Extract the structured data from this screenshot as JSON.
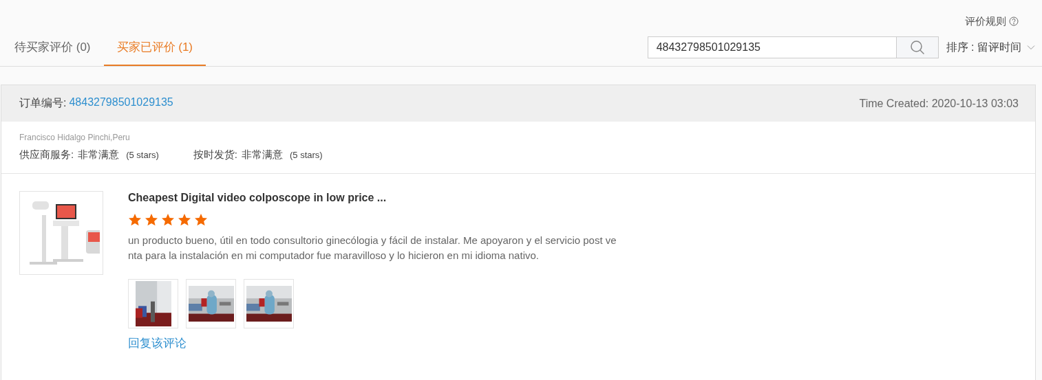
{
  "rules_link": "评价规则",
  "tabs": [
    {
      "label": "待买家评价 (0)",
      "selected": false
    },
    {
      "label": "买家已评价 (1)",
      "selected": true
    }
  ],
  "search": {
    "value": "48432798501029135"
  },
  "sort": {
    "label": "排序 : 留评时间"
  },
  "order": {
    "label": "订单编号:",
    "number": "48432798501029135",
    "time_created": "Time Created: 2020-10-13 03:03",
    "buyer": "Francisco Hidalgo Pinchi,Peru",
    "ratings": [
      {
        "label": "供应商服务:",
        "value": "非常满意",
        "note": "(5 stars)"
      },
      {
        "label": "按时发货:",
        "value": "非常满意",
        "note": "(5 stars)"
      }
    ],
    "product": {
      "image": {
        "kind": "picture"
      },
      "title": "Cheapest Digital video colposcope in low price ...",
      "stars": 5,
      "comment_lines": [
        "un producto bueno, útil en todo consultorio ginecólogia y fácil de instalar. Me apoyaron y el servicio post ve",
        "nta para la instalación en mi computador fue maravilloso y lo hicieron en mi idioma nativo."
      ],
      "photos": [
        {
          "kind": "picture"
        },
        {
          "kind": "picture"
        },
        {
          "kind": "picture"
        }
      ],
      "reply_link": "回复该评论"
    }
  }
}
